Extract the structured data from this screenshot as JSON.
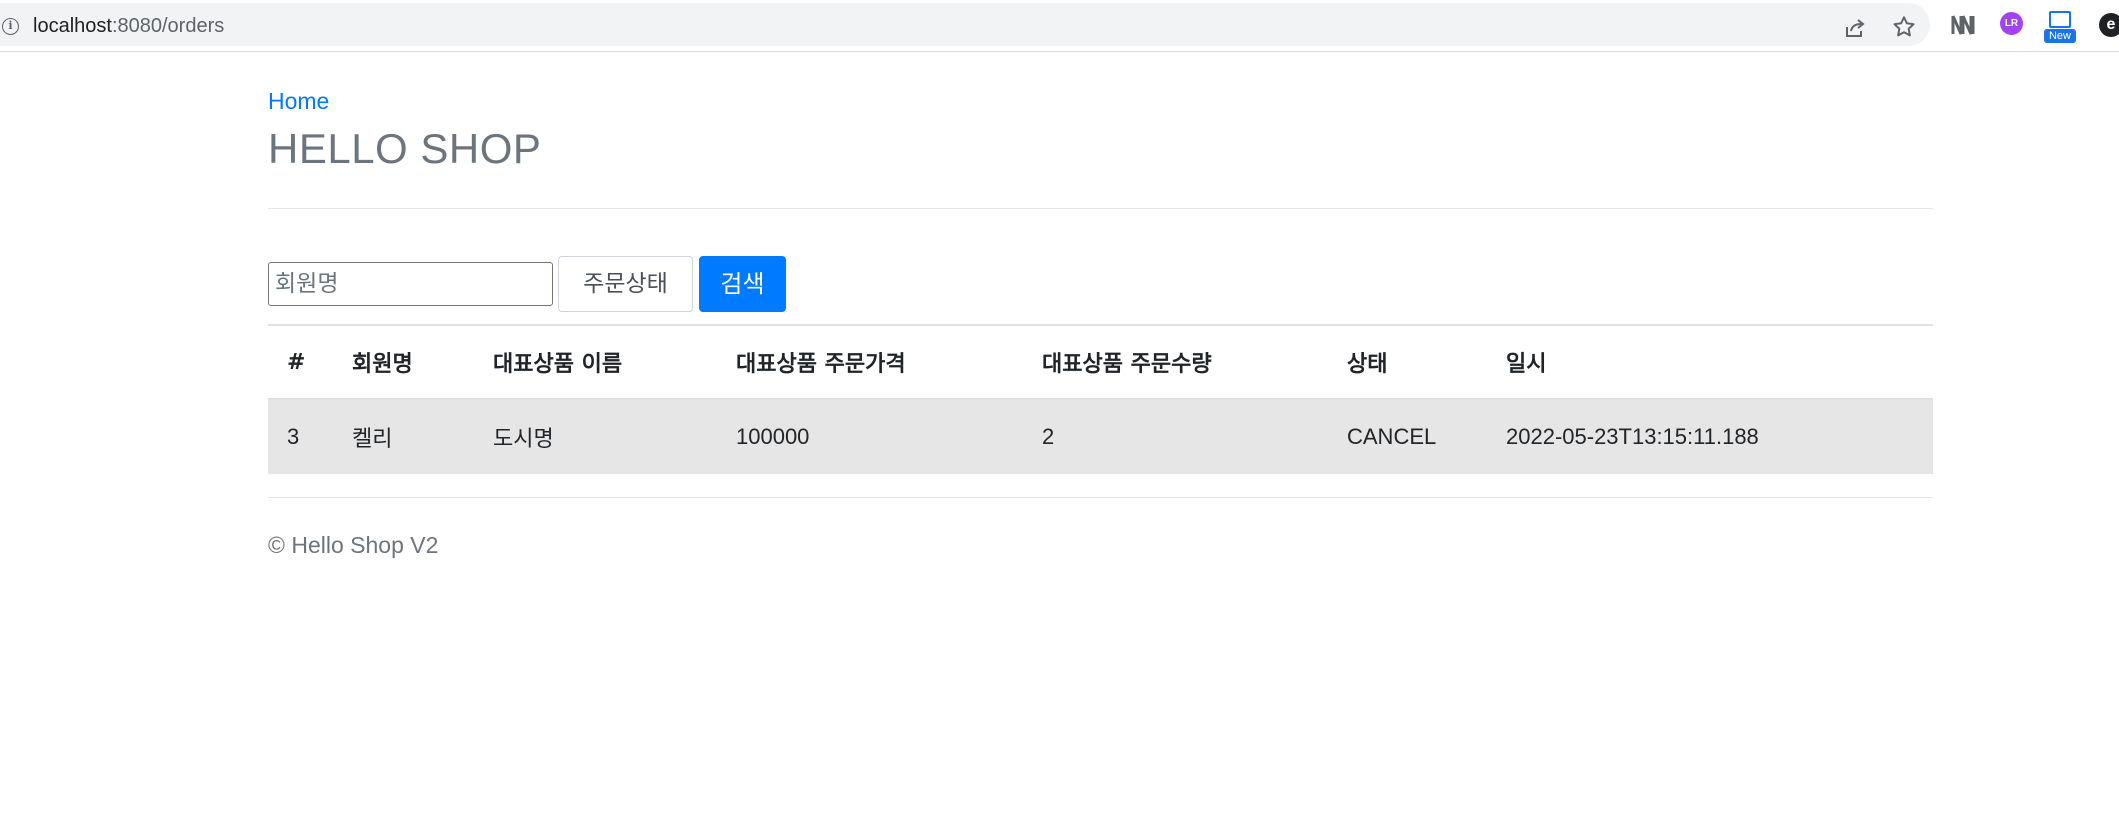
{
  "browser": {
    "url_host": "localhost",
    "url_path": ":8080/orders",
    "icons": [
      "info-icon",
      "share-icon",
      "star-icon",
      "notion-extension-icon",
      "lr-extension-icon",
      "screen-capture-extension-icon",
      "edge-extension-icon"
    ],
    "ext2_label": "LR",
    "ext3_badge": "New",
    "ext4_label": "e"
  },
  "header": {
    "breadcrumb": "Home",
    "title": "HELLO SHOP"
  },
  "search": {
    "member_placeholder": "회원명",
    "status_label": "주문상태",
    "search_button": "검색"
  },
  "table": {
    "columns": [
      "#",
      "회원명",
      "대표상품 이름",
      "대표상품 주문가격",
      "대표상품 주문수량",
      "상태",
      "일시"
    ],
    "rows": [
      [
        "3",
        "켈리",
        "도시명",
        "100000",
        "2",
        "CANCEL",
        "2022-05-23T13:15:11.188"
      ]
    ]
  },
  "footer": {
    "text": "© Hello Shop V2"
  },
  "colors": {
    "primary": "#007bff",
    "muted": "#6c757d",
    "row_highlight": "#e6e6e6"
  }
}
